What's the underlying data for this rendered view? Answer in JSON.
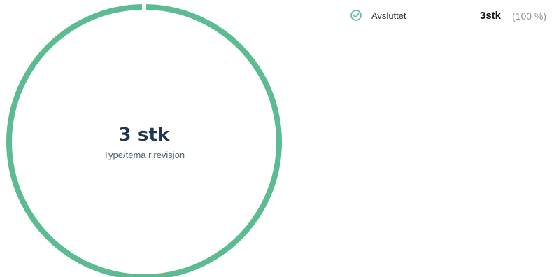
{
  "chart_data": {
    "type": "pie",
    "categories": [
      "Avsluttet"
    ],
    "values": [
      3
    ],
    "center_value": "3 stk",
    "center_label": "Type/tema r.revisjon",
    "legend": [
      {
        "label": "Avsluttet",
        "value": "3stk",
        "percent": "(100 %)",
        "icon": "check-circle-icon",
        "color": "#5dbb92"
      }
    ]
  }
}
